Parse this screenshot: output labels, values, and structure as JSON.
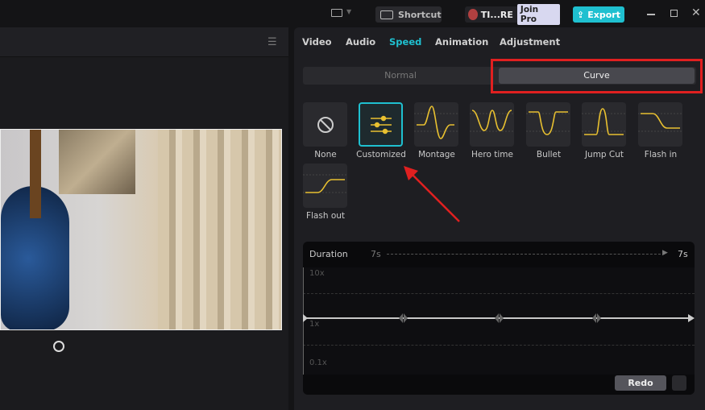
{
  "topbar": {
    "shortcut": "Shortcut",
    "user": "TI...RE",
    "join_pro": "Join Pro",
    "export": "Export",
    "accent": "#1fc0d0"
  },
  "tabs": [
    {
      "label": "Video"
    },
    {
      "label": "Audio"
    },
    {
      "label": "Speed",
      "active": true
    },
    {
      "label": "Animation"
    },
    {
      "label": "Adjustment"
    }
  ],
  "mode": {
    "normal": "Normal",
    "curve": "Curve",
    "selected": "Curve"
  },
  "presets": [
    {
      "label": "None",
      "icon": "none-icon"
    },
    {
      "label": "Customized",
      "icon": "sliders-icon",
      "selected": true
    },
    {
      "label": "Montage"
    },
    {
      "label": "Hero time"
    },
    {
      "label": "Bullet"
    },
    {
      "label": "Jump Cut"
    },
    {
      "label": "Flash in"
    },
    {
      "label": "Flash out"
    }
  ],
  "curve": {
    "duration_label": "Duration",
    "start": "7s",
    "end": "7s",
    "y_max": "10x",
    "y_mid": "1x",
    "y_min": "0.1x",
    "redo": "Redo"
  },
  "colors": {
    "curve_yellow": "#e8c030",
    "highlight_red": "#e02020"
  }
}
